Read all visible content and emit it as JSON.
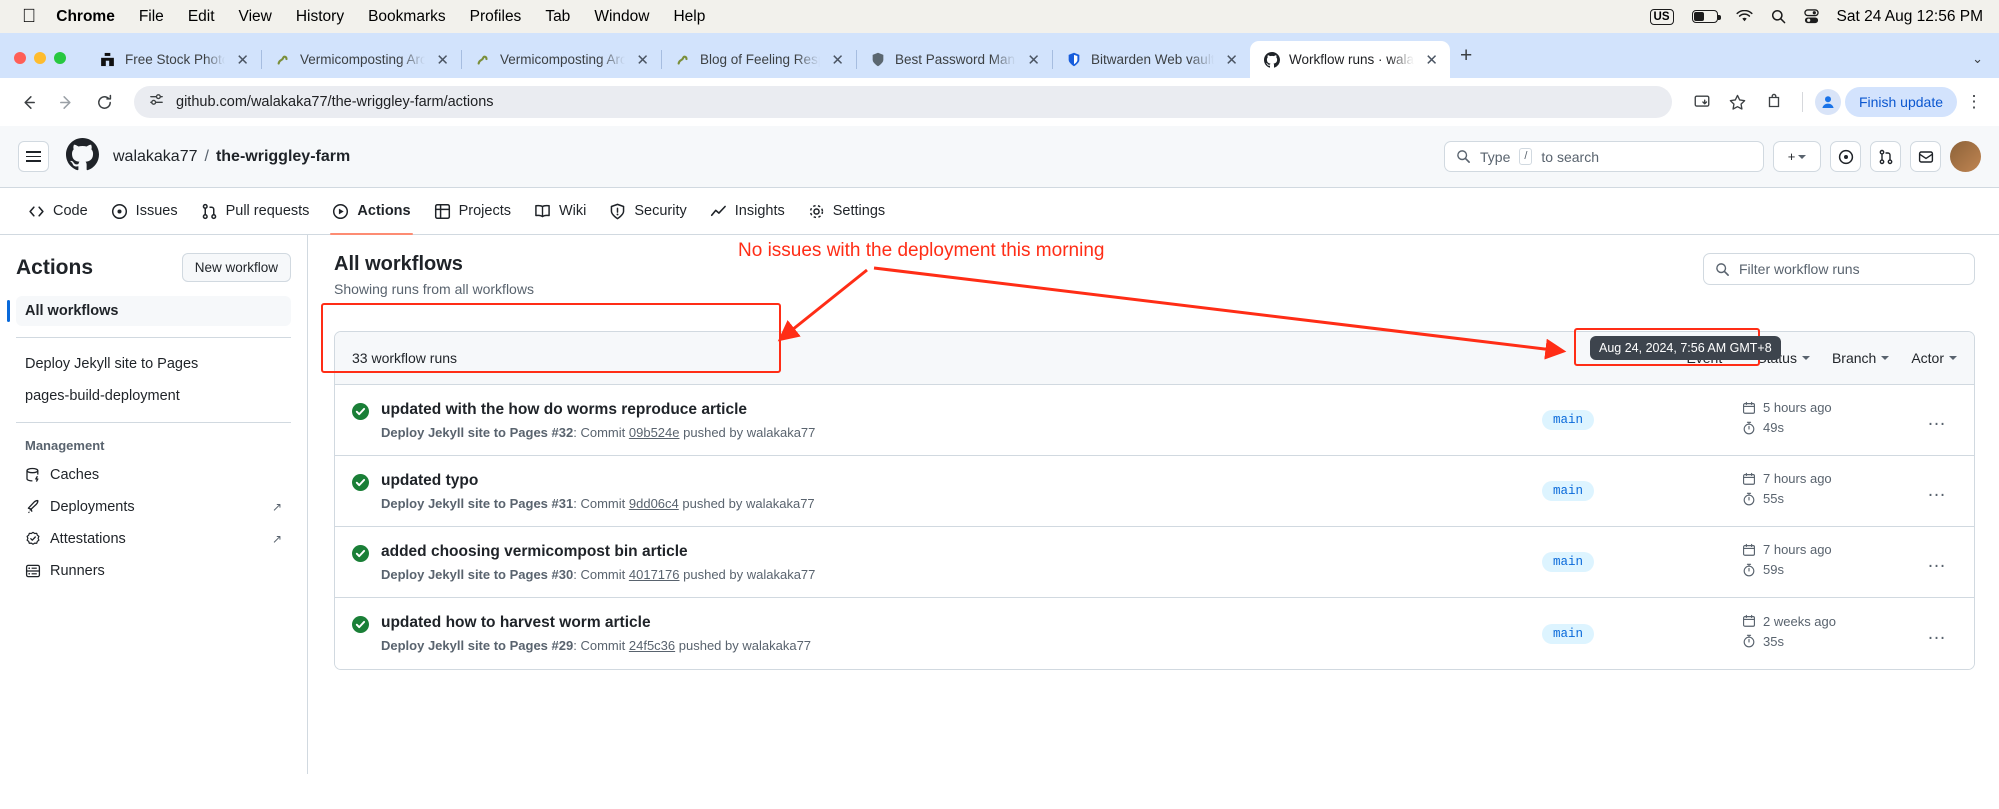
{
  "os_menu": {
    "apple_icon": "apple-icon",
    "items": [
      {
        "label": "Chrome",
        "bold": true
      },
      {
        "label": "File",
        "bold": false
      },
      {
        "label": "Edit",
        "bold": false
      },
      {
        "label": "View",
        "bold": false
      },
      {
        "label": "History",
        "bold": false
      },
      {
        "label": "Bookmarks",
        "bold": false
      },
      {
        "label": "Profiles",
        "bold": false
      },
      {
        "label": "Tab",
        "bold": false
      },
      {
        "label": "Window",
        "bold": false
      },
      {
        "label": "Help",
        "bold": false
      }
    ],
    "status": {
      "input_source": "US",
      "battery_icon": "battery-icon",
      "wifi_icon": "wifi-icon",
      "search_icon": "spotlight-search-icon",
      "control_center_icon": "control-center-icon",
      "clock": "Sat 24 Aug  12:56 PM"
    }
  },
  "browser": {
    "tabs": [
      {
        "title": "Free Stock Photos & Imag",
        "favicon": "unsplash-icon",
        "active": false
      },
      {
        "title": "Vermicomposting Archive",
        "favicon": "worm-icon",
        "active": false
      },
      {
        "title": "Vermicomposting Archive",
        "favicon": "worm-icon",
        "active": false
      },
      {
        "title": "Blog of Feeling Responsiv",
        "favicon": "worm-icon",
        "active": false
      },
      {
        "title": "Best Password Manager f",
        "favicon": "shield-icon",
        "active": false
      },
      {
        "title": "Bitwarden Web vault",
        "favicon": "bitwarden-icon",
        "active": false
      },
      {
        "title": "Workflow runs · walakaka",
        "favicon": "github-icon",
        "active": true
      }
    ],
    "new_tab_label": "+",
    "tab_list_label": "⌄",
    "toolbar": {
      "back_label": "←",
      "forward_label": "→",
      "reload_label": "↻",
      "site_info_icon": "site-settings-icon",
      "url": "github.com/walakaka77/the-wriggley-farm/actions",
      "install_icon": "install-app-icon",
      "bookmark_icon": "star-icon",
      "extensions_icon": "extensions-icon",
      "profile_icon": "profile-avatar-icon",
      "finish_update_label": "Finish update",
      "menu_label": "⋮"
    }
  },
  "github": {
    "header": {
      "menu_icon": "hamburger-menu-icon",
      "logo_icon": "github-mark-icon",
      "owner": "walakaka77",
      "separator": "/",
      "repo": "the-wriggley-farm",
      "search_placeholder": "Type",
      "search_key": "/",
      "search_suffix": "to search",
      "create_new_label": "+",
      "issues_icon": "issues-global-icon",
      "pull_requests_icon": "pull-requests-global-icon",
      "inbox_icon": "inbox-icon",
      "avatar_icon": "user-avatar"
    },
    "nav": [
      {
        "label": "Code",
        "icon": "code-icon",
        "active": false
      },
      {
        "label": "Issues",
        "icon": "issue-opened-icon",
        "active": false
      },
      {
        "label": "Pull requests",
        "icon": "git-pull-request-icon",
        "active": false
      },
      {
        "label": "Actions",
        "icon": "play-icon",
        "active": true
      },
      {
        "label": "Projects",
        "icon": "table-icon",
        "active": false
      },
      {
        "label": "Wiki",
        "icon": "book-icon",
        "active": false
      },
      {
        "label": "Security",
        "icon": "shield-icon",
        "active": false
      },
      {
        "label": "Insights",
        "icon": "graph-icon",
        "active": false
      },
      {
        "label": "Settings",
        "icon": "gear-icon",
        "active": false
      }
    ],
    "sidebar": {
      "title": "Actions",
      "new_workflow_label": "New workflow",
      "all_workflows": "All workflows",
      "workflows": [
        {
          "label": "Deploy Jekyll site to Pages"
        },
        {
          "label": "pages-build-deployment"
        }
      ],
      "management_title": "Management",
      "management": [
        {
          "label": "Caches",
          "icon": "cache-icon",
          "external": false
        },
        {
          "label": "Deployments",
          "icon": "rocket-icon",
          "external": true
        },
        {
          "label": "Attestations",
          "icon": "verified-icon",
          "external": true
        },
        {
          "label": "Runners",
          "icon": "server-icon",
          "external": false
        }
      ],
      "external_glyph": "↗"
    },
    "main": {
      "title": "All workflows",
      "subtitle": "Showing runs from all workflows",
      "filter_placeholder": "Filter workflow runs",
      "runs_count": "33 workflow runs",
      "filters": [
        {
          "label": "Event"
        },
        {
          "label": "Status"
        },
        {
          "label": "Branch"
        },
        {
          "label": "Actor"
        }
      ],
      "runs": [
        {
          "status_icon": "success-check-icon",
          "title": "updated with the how do worms reproduce article",
          "workflow": "Deploy Jekyll site to Pages",
          "run_number": "#32",
          "commit_label": "Commit",
          "commit_sha": "09b524e",
          "pushed_by": "pushed by walakaka77",
          "branch": "main",
          "relative_time": "5 hours ago",
          "duration": "49s",
          "more_label": "…"
        },
        {
          "status_icon": "success-check-icon",
          "title": "updated typo",
          "workflow": "Deploy Jekyll site to Pages",
          "run_number": "#31",
          "commit_label": "Commit",
          "commit_sha": "9dd06c4",
          "pushed_by": "pushed by walakaka77",
          "branch": "main",
          "relative_time": "7 hours ago",
          "duration": "55s",
          "more_label": "…"
        },
        {
          "status_icon": "success-check-icon",
          "title": "added choosing vermicompost bin article",
          "workflow": "Deploy Jekyll site to Pages",
          "run_number": "#30",
          "commit_label": "Commit",
          "commit_sha": "4017176",
          "pushed_by": "pushed by walakaka77",
          "branch": "main",
          "relative_time": "7 hours ago",
          "duration": "59s",
          "more_label": "…"
        },
        {
          "status_icon": "success-check-icon",
          "title": "updated how to harvest worm article",
          "workflow": "Deploy Jekyll site to Pages",
          "run_number": "#29",
          "commit_label": "Commit",
          "commit_sha": "24f5c36",
          "pushed_by": "pushed by walakaka77",
          "branch": "main",
          "relative_time": "2 weeks ago",
          "duration": "35s",
          "more_label": "…"
        }
      ]
    },
    "tooltip": {
      "text": "Aug 24, 2024, 7:56 AM GMT+8"
    },
    "annotation": {
      "text": "No issues with the deployment this morning",
      "color": "#ff2d16"
    }
  }
}
